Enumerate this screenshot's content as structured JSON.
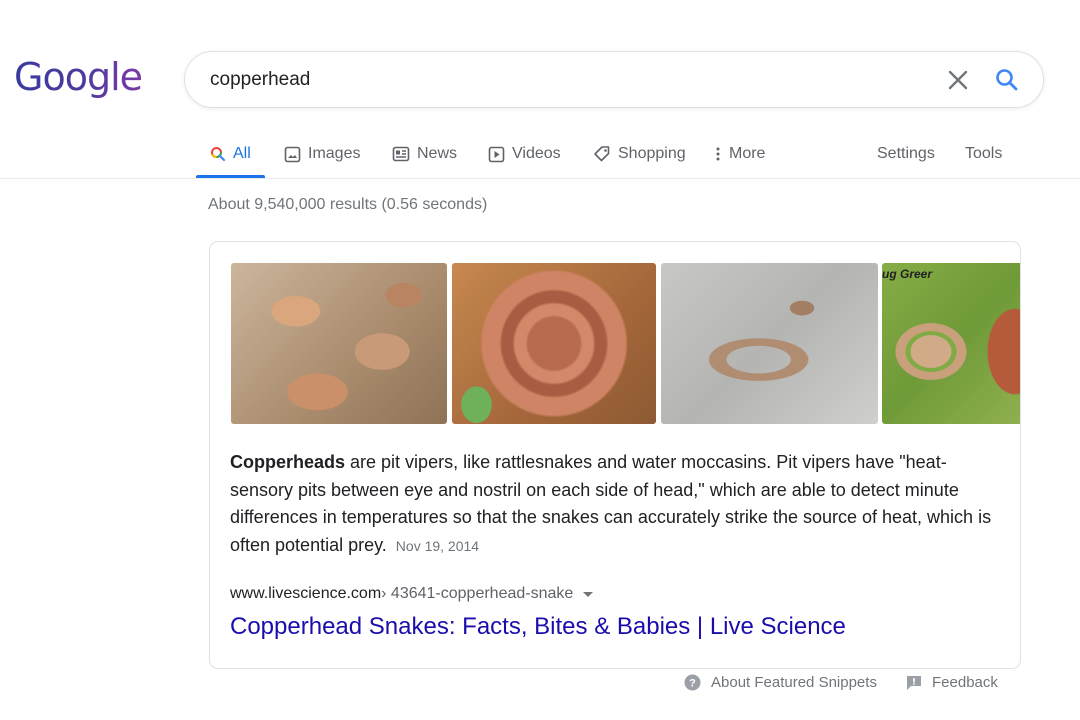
{
  "header": {
    "logo_text": "Google",
    "search": {
      "value": "copperhead",
      "clear_icon": "close-icon",
      "search_icon": "search-icon"
    }
  },
  "tabs": [
    {
      "label": "All",
      "icon": "search-icon",
      "active": true
    },
    {
      "label": "Images",
      "icon": "image-icon",
      "active": false
    },
    {
      "label": "News",
      "icon": "newspaper-icon",
      "active": false
    },
    {
      "label": "Videos",
      "icon": "play-icon",
      "active": false
    },
    {
      "label": "Shopping",
      "icon": "tag-icon",
      "active": false
    },
    {
      "label": "More",
      "icon": "more-vert-icon",
      "active": false
    }
  ],
  "tools": {
    "settings_label": "Settings",
    "tools_label": "Tools"
  },
  "result_stats": "About 9,540,000 results (0.56 seconds)",
  "featured_snippet": {
    "images": [
      {
        "alt": "Copperhead snake on leaves"
      },
      {
        "alt": "Coiled copperhead snake"
      },
      {
        "alt": "Juvenile copperhead on gravel"
      },
      {
        "alt": "Copperhead on moss",
        "credit": "ug Greer"
      }
    ],
    "text_bold": "Copperheads",
    "text": " are pit vipers, like rattlesnakes and water moccasins. Pit vipers have \"heat-sensory pits between eye and nostril on each side of head,\" which are able to detect minute differences in temperatures so that the snakes can accurately strike the source of heat, which is often potential prey.",
    "date": "Nov 19, 2014",
    "cite_domain": "www.livescience.com",
    "cite_path": " › 43641-copperhead-snake",
    "title": "Copperhead Snakes: Facts, Bites & Babies | Live Science"
  },
  "footer": {
    "about_label": "About Featured Snippets",
    "feedback_label": "Feedback"
  },
  "colors": {
    "accent": "#1a73e8",
    "link": "#1a0dab",
    "muted": "#70757a"
  }
}
